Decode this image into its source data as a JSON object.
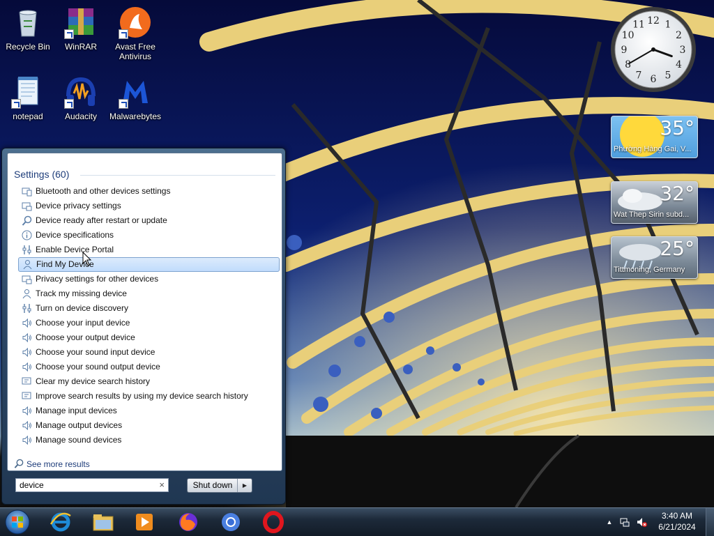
{
  "desktop": {
    "icons": [
      {
        "label": "Recycle Bin",
        "icon": "recycle-bin-icon"
      },
      {
        "label": "WinRAR",
        "icon": "winrar-icon"
      },
      {
        "label": "Avast Free Antivirus",
        "icon": "avast-icon"
      },
      {
        "label": "notepad",
        "icon": "notepad-icon"
      },
      {
        "label": "Audacity",
        "icon": "audacity-icon"
      },
      {
        "label": "Malwarebytes",
        "icon": "malwarebytes-icon"
      }
    ]
  },
  "gadgets": {
    "clock": {
      "hour": 3,
      "minute": 40
    },
    "weather": [
      {
        "temp": "35°",
        "location": "Phường Hàng Gai, V...",
        "condition": "sunny"
      },
      {
        "temp": "32°",
        "location": "Wat Thep Sirin subd...",
        "condition": "cloudy"
      },
      {
        "temp": "25°",
        "location": "Tittmoning, Germany",
        "condition": "rain"
      }
    ]
  },
  "start_menu": {
    "group_header": "Settings (60)",
    "results": [
      {
        "label": "Bluetooth and other devices settings",
        "icon": "devices-icon"
      },
      {
        "label": "Device privacy settings",
        "icon": "privacy-icon"
      },
      {
        "label": "Device ready after restart or update",
        "icon": "search-icon"
      },
      {
        "label": "Device specifications",
        "icon": "info-icon"
      },
      {
        "label": "Enable Device Portal",
        "icon": "developer-icon"
      },
      {
        "label": "Find My Device",
        "icon": "person-icon",
        "selected": true
      },
      {
        "label": "Privacy settings for other devices",
        "icon": "privacy-icon"
      },
      {
        "label": "Track my missing device",
        "icon": "person-icon"
      },
      {
        "label": "Turn on device discovery",
        "icon": "developer-icon"
      },
      {
        "label": "Choose your input device",
        "icon": "speaker-icon"
      },
      {
        "label": "Choose your output device",
        "icon": "speaker-icon"
      },
      {
        "label": "Choose your sound input device",
        "icon": "speaker-icon"
      },
      {
        "label": "Choose your sound output device",
        "icon": "speaker-icon"
      },
      {
        "label": "Clear my device search history",
        "icon": "history-icon"
      },
      {
        "label": "Improve search results by using my device search history",
        "icon": "history-icon"
      },
      {
        "label": "Manage input devices",
        "icon": "speaker-icon"
      },
      {
        "label": "Manage output devices",
        "icon": "speaker-icon"
      },
      {
        "label": "Manage sound devices",
        "icon": "speaker-icon"
      }
    ],
    "see_more": "See more results",
    "search_value": "device",
    "clear_symbol": "×",
    "shutdown_label": "Shut down",
    "shutdown_arrow": "▶"
  },
  "taskbar": {
    "apps": [
      "internet-explorer-icon",
      "file-explorer-icon",
      "media-player-icon",
      "firefox-icon",
      "chrome-icon",
      "opera-icon"
    ],
    "tray": [
      "show-hidden-icons-arrow",
      "network-icon",
      "volume-muted-icon"
    ],
    "time": "3:40 AM",
    "date": "6/21/2024"
  },
  "colors": {
    "accent": "#1e3d7a",
    "selection": "#c1dcfc",
    "taskbar": "#1d2a3a"
  }
}
